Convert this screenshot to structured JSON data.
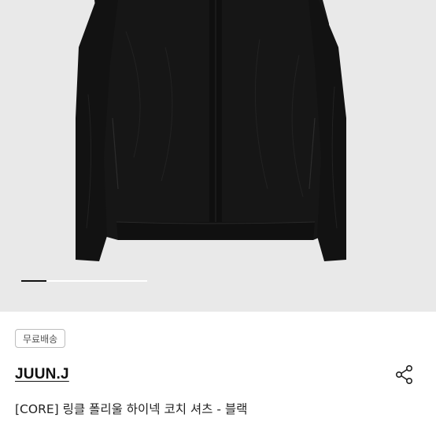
{
  "gallery": {
    "slide_progress": 0.2,
    "image_alt": "black coach shirt"
  },
  "badge": {
    "label": "무료배송"
  },
  "brand": {
    "name": "JUUN.J"
  },
  "product": {
    "title": "[CORE] 링클 폴리울 하이넥 코치 셔츠 - 블랙"
  },
  "icons": {
    "share": "share-icon"
  },
  "colors": {
    "gallery_bg": "#e9e9e9",
    "garment": "#141414",
    "text": "#111111"
  }
}
